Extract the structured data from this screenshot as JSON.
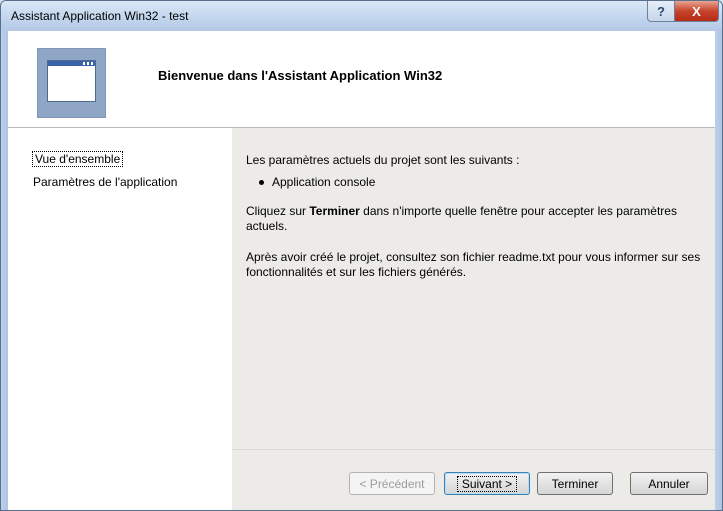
{
  "window": {
    "title": "Assistant Application Win32 - test",
    "help_glyph": "?",
    "close_glyph": "X"
  },
  "header": {
    "title": "Bienvenue dans l'Assistant Application Win32"
  },
  "nav": {
    "items": [
      {
        "label": "Vue d'ensemble",
        "selected": true
      },
      {
        "label": "Paramètres de l'application",
        "selected": false
      }
    ]
  },
  "content": {
    "intro": "Les paramètres actuels du projet sont les suivants :",
    "bullets": [
      "Application console"
    ],
    "finish_prefix": "Cliquez sur ",
    "finish_bold": "Terminer",
    "finish_suffix": " dans n'importe quelle fenêtre pour accepter les paramètres actuels.",
    "readme": "Après avoir créé le projet, consultez son fichier readme.txt pour vous informer sur ses fonctionnalités et sur les fichiers générés."
  },
  "buttons": {
    "previous": "< Précédent",
    "next": "Suivant >",
    "finish": "Terminer",
    "cancel": "Annuler"
  },
  "colors": {
    "close_button": "#c8432b",
    "content_background": "#ecebe8",
    "default_button_border": "#3c7fb1"
  }
}
